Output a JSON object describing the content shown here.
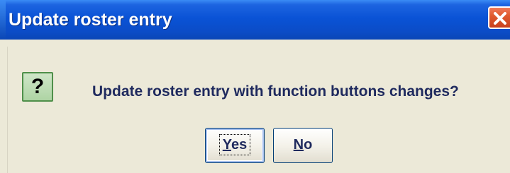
{
  "window": {
    "title": "Update roster entry"
  },
  "dialog": {
    "icon": "question-icon",
    "icon_glyph": "?",
    "message": "Update roster entry with function buttons changes?",
    "buttons": {
      "yes": {
        "mnemonic": "Y",
        "rest": "es"
      },
      "no": {
        "mnemonic": "N",
        "rest": "o"
      }
    }
  },
  "colors": {
    "titlebar": "#0a53d6",
    "close_button": "#e05a2e",
    "dialog_bg": "#ece9d8",
    "text": "#1f2a5e"
  }
}
